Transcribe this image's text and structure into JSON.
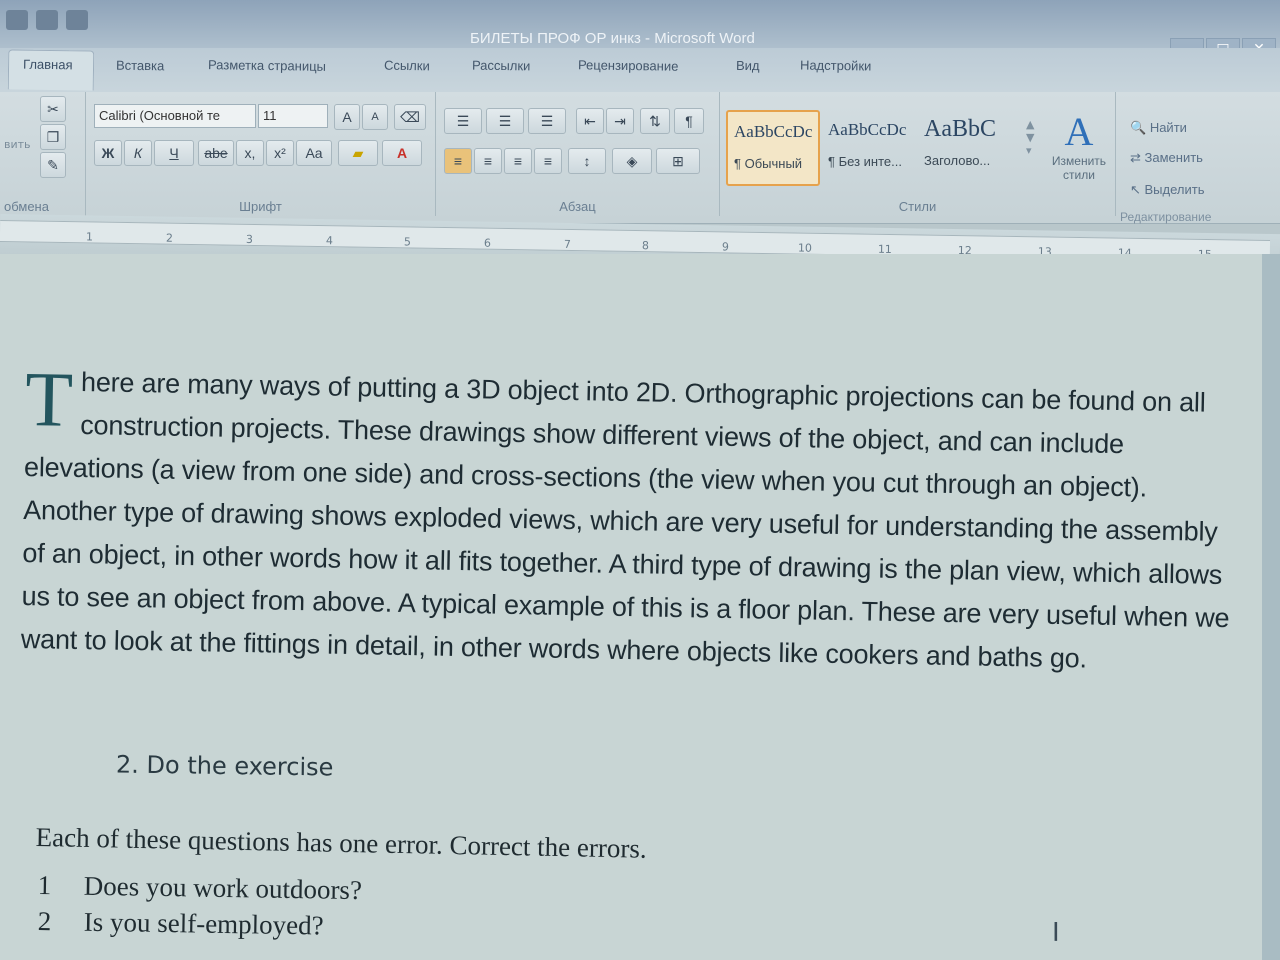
{
  "window": {
    "title": "БИЛЕТЫ ПРОФ ОР инкз - Microsoft Word",
    "minimize": "–",
    "maximize": "□",
    "close": "✕"
  },
  "tabs": [
    {
      "label": "Главная"
    },
    {
      "label": "Вставка"
    },
    {
      "label": "Разметка страницы"
    },
    {
      "label": "Ссылки"
    },
    {
      "label": "Рассылки"
    },
    {
      "label": "Рецензирование"
    },
    {
      "label": "Вид"
    },
    {
      "label": "Надстройки"
    }
  ],
  "ribbon": {
    "clipboard": {
      "label": "обмена",
      "paste_label": "вить"
    },
    "font": {
      "label": "Шрифт",
      "font_name": "Calibri (Основной те",
      "font_size": "11",
      "grow": "A",
      "shrink": "A",
      "bold": "Ж",
      "italic": "К",
      "underline": "Ч",
      "strike": "abe",
      "subscript": "x,",
      "superscript": "x²",
      "case": "Aa",
      "font_color": "A"
    },
    "paragraph": {
      "label": "Абзац",
      "show_marks": "¶"
    },
    "styles": {
      "label": "Стили",
      "items": [
        {
          "sample": "AaBbCcDc",
          "name": "¶ Обычный"
        },
        {
          "sample": "AaBbCcDc",
          "name": "¶ Без инте..."
        },
        {
          "sample": "AaBbC",
          "name": "Заголово..."
        }
      ],
      "change_label": "Изменить стили"
    },
    "editing": {
      "label": "Редактирование",
      "find": "Найти",
      "replace": "Заменить",
      "select": "Выделить"
    }
  },
  "ruler": {
    "ticks": [
      "1",
      "2",
      "3",
      "4",
      "5",
      "6",
      "7",
      "8",
      "9",
      "10",
      "11",
      "12",
      "13",
      "14",
      "15"
    ]
  },
  "document": {
    "dropcap": "T",
    "paragraph": "here are many ways of putting a 3D object into 2D. Orthographic projections can be found on all construction projects. These drawings show different views of the object, and can include elevations (a view from one side) and cross-sections (the view when you cut through an object). Another type of drawing shows exploded views, which are very useful for understanding the assembly of an object, in other words how it all fits together. A third type of drawing is the plan view, which allows us to see an object from above. A typical example of this is a floor plan. These are very useful when we want to look at the fittings in detail, in other words where objects like cookers and baths go.",
    "exercise": "2. Do the exercise",
    "instruction": "Each of these questions has one error. Correct the errors.",
    "questions": [
      {
        "num": "1",
        "text": "Does you work outdoors?"
      },
      {
        "num": "2",
        "text": "Is you self-employed?"
      }
    ]
  },
  "colors": {
    "accent": "#e6a24c",
    "dropcap": "#23555e",
    "text": "#1e2c33"
  }
}
